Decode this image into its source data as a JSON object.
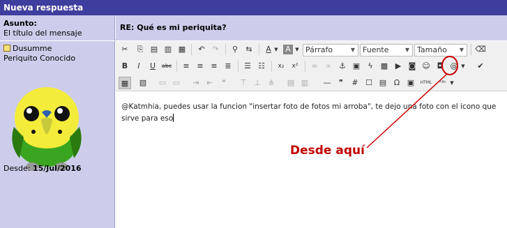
{
  "title": "Nueva respuesta",
  "subject": {
    "label": "Asunto:",
    "hint": "El título del mensaje",
    "value": "RE: Qué es mi periquita?"
  },
  "user": {
    "name": "Dusumme",
    "rank": "Periquito Conocido",
    "since_label": "Desde:",
    "since_date": "15/Jul/2016"
  },
  "toolbar": {
    "format": "Párrafo",
    "font": "Fuente",
    "size": "Tamaño",
    "font_color_glyph": "A",
    "bg_color_glyph": "A"
  },
  "message": {
    "text": "@Katmhia, puedes usar la funcion \"insertar foto de fotos mi arroba\", te dejo una foto con el icono que sirve para eso"
  },
  "annotation": {
    "text": "Desde aquí",
    "color": "#cc0000"
  },
  "colors": {
    "header": "#3e3e9e",
    "panel": "#cdcdeb"
  }
}
